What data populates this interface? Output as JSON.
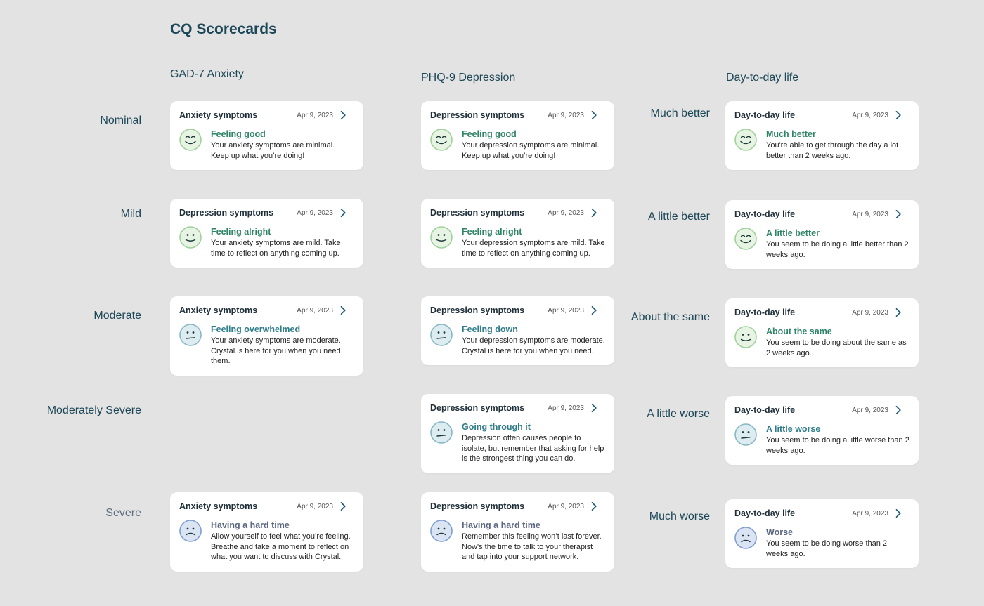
{
  "page_title": "CQ Scorecards",
  "columns": {
    "gad7": "GAD-7 Anxiety",
    "phq9": "PHQ-9 Depression",
    "dtd": "Day-to-day life"
  },
  "row_labels": [
    "Nominal",
    "Mild",
    "Moderate",
    "Moderately Severe",
    "Severe"
  ],
  "dtd_labels": [
    "Much better",
    "A little better",
    "About the same",
    "A little worse",
    "Much worse"
  ],
  "colors": {
    "background": "#e3e3e3",
    "heading": "#1c4757",
    "green_status": "#2f8466",
    "teal_status": "#2e7d8a",
    "slate_status": "#5a6581"
  },
  "cards": {
    "gad7": [
      {
        "title": "Anxiety symptoms",
        "date": "Apr 9, 2023",
        "status": "Feeling good",
        "text": "Your anxiety symptoms are minimal. Keep up what you’re doing!",
        "icon": "smile-closed-eyes-icon"
      },
      {
        "title": "Depression symptoms",
        "date": "Apr 9, 2023",
        "status": "Feeling alright",
        "text": "Your anxiety symptoms are mild. Take time to reflect on anything coming up.",
        "icon": "slight-smile-icon"
      },
      {
        "title": "Anxiety symptoms",
        "date": "Apr 9, 2023",
        "status": "Feeling overwhelmed",
        "text": "Your anxiety symptoms are moderate. Crystal is here for you when you need them.",
        "icon": "uneasy-face-icon"
      },
      {
        "title": "Anxiety symptoms",
        "date": "Apr 9, 2023",
        "status": "Having a hard time",
        "text": "Allow yourself to feel what you’re feeling. Breathe and take a moment to reflect on what you want to discuss with Crystal.",
        "icon": "sad-face-icon"
      }
    ],
    "phq9": [
      {
        "title": "Depression symptoms",
        "date": "Apr 9, 2023",
        "status": "Feeling good",
        "text": "Your depression symptoms are minimal. Keep up what you’re doing!",
        "icon": "smile-closed-eyes-icon"
      },
      {
        "title": "Depression symptoms",
        "date": "Apr 9, 2023",
        "status": "Feeling alright",
        "text": "Your depression symptoms are mild. Take time to reflect on anything coming up.",
        "icon": "slight-smile-icon"
      },
      {
        "title": "Depression symptoms",
        "date": "Apr 9, 2023",
        "status": "Feeling down",
        "text": "Your depression symptoms are moderate. Crystal is here for you when you need.",
        "icon": "uneasy-face-icon"
      },
      {
        "title": "Depression symptoms",
        "date": "Apr 9, 2023",
        "status": "Going through it",
        "text": "Depression often causes people to isolate, but remember that asking for help is the strongest thing you can do.",
        "icon": "uneasy-face-icon"
      },
      {
        "title": "Depression symptoms",
        "date": "Apr 9, 2023",
        "status": "Having a hard time",
        "text": "Remember this feeling won’t last forever. Now's the time to talk to your therapist and tap into your support network.",
        "icon": "sad-face-icon"
      }
    ],
    "dtd": [
      {
        "title": "Day-to-day life",
        "date": "Apr 9, 2023",
        "status": "Much better",
        "text": "You're able to get through the day a lot better than 2 weeks ago.",
        "icon": "smile-closed-eyes-icon"
      },
      {
        "title": "Day-to-day life",
        "date": "Apr 9, 2023",
        "status": "A little better",
        "text": "You seem to be doing a little better than 2 weeks ago.",
        "icon": "smile-closed-eyes-icon"
      },
      {
        "title": "Day-to-day life",
        "date": "Apr 9, 2023",
        "status": "About the same",
        "text": "You seem to be doing about the same as 2 weeks ago.",
        "icon": "slight-smile-icon"
      },
      {
        "title": "Day-to-day life",
        "date": "Apr 9, 2023",
        "status": "A little worse",
        "text": "You seem to be doing a little worse than 2 weeks ago.",
        "icon": "uneasy-face-icon"
      },
      {
        "title": "Day-to-day life",
        "date": "Apr 9, 2023",
        "status": "Worse",
        "text": "You seem to be doing worse than 2 weeks ago.",
        "icon": "sad-face-icon"
      }
    ]
  }
}
